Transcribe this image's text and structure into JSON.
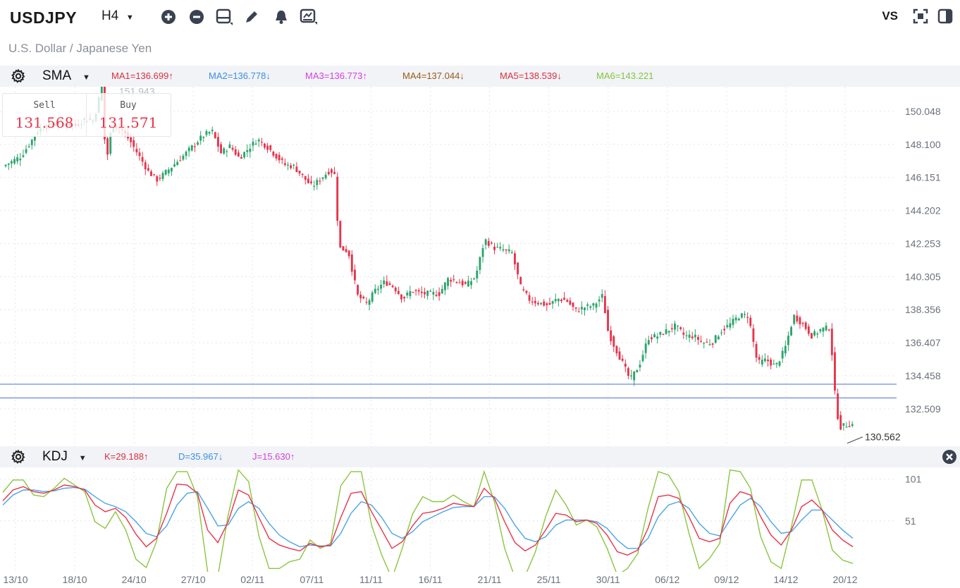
{
  "header": {
    "symbol": "USDJPY",
    "subtitle": "U.S. Dollar / Japanese Yen",
    "timeframe": "H4",
    "compare_label": "VS",
    "icons": [
      "zoom-in-icon",
      "zoom-out-icon",
      "layout-icon",
      "draw-pencil-icon",
      "alert-bell-icon",
      "indicator-chart-icon",
      "fullscreen-icon",
      "panel-toggle-icon"
    ]
  },
  "main_indicator": {
    "name": "SMA",
    "values": [
      {
        "label": "MA1=136.699↑",
        "color": "#d9303f"
      },
      {
        "label": "MA2=136.778↓",
        "color": "#3b8fe0"
      },
      {
        "label": "MA3=136.773↑",
        "color": "#d63fe0"
      },
      {
        "label": "MA4=137.044↓",
        "color": "#9a5a16"
      },
      {
        "label": "MA5=138.539↓",
        "color": "#d9303f"
      },
      {
        "label": "MA6=143.221",
        "color": "#86c43a"
      }
    ]
  },
  "sub_indicator": {
    "name": "KDJ",
    "values": [
      {
        "label": "K=29.188↑",
        "color": "#d9303f"
      },
      {
        "label": "D=35.967↓",
        "color": "#3b8fe0"
      },
      {
        "label": "J=15.630↑",
        "color": "#d63fe0"
      }
    ]
  },
  "trade": {
    "sell_label": "Sell",
    "sell_price": "131.568",
    "buy_label": "Buy",
    "buy_price": "131.571"
  },
  "annotations": {
    "high_label": "151.943",
    "low_label": "130.562"
  },
  "colors": {
    "up": "#2aa56b",
    "down": "#e8334a",
    "hline": "#5b7fd6",
    "k": "#e8334a",
    "d": "#4aa3ea",
    "j": "#8bc53f"
  },
  "chart_data": [
    {
      "type": "candlestick",
      "title": "USDJPY H4",
      "y_ticks": [
        "150.048",
        "148.100",
        "146.151",
        "144.202",
        "142.253",
        "140.305",
        "138.356",
        "136.407",
        "134.458",
        "132.509"
      ],
      "x_ticks": [
        "13/10",
        "18/10",
        "24/10",
        "27/10",
        "02/11",
        "07/11",
        "11/11",
        "16/11",
        "21/11",
        "25/11",
        "30/11",
        "06/12",
        "09/12",
        "14/12",
        "20/12"
      ],
      "ylim": [
        130.3,
        151.5
      ],
      "horizontal_lines": [
        133.96,
        133.15
      ],
      "high": 151.943,
      "low": 130.562,
      "close_path": [
        [
          0,
          146.8
        ],
        [
          2,
          147.4
        ],
        [
          4,
          149.0
        ],
        [
          6,
          149.4
        ],
        [
          8,
          149.2
        ],
        [
          9,
          149.6
        ],
        [
          10,
          149.5
        ],
        [
          11,
          151.8
        ],
        [
          11.3,
          146.7
        ],
        [
          12,
          149.3
        ],
        [
          13,
          149.0
        ],
        [
          14,
          148.3
        ],
        [
          16,
          146.5
        ],
        [
          17,
          146.0
        ],
        [
          18,
          146.5
        ],
        [
          20,
          147.5
        ],
        [
          22,
          148.6
        ],
        [
          23,
          148.9
        ],
        [
          24,
          147.6
        ],
        [
          25,
          148.0
        ],
        [
          26,
          147.3
        ],
        [
          28,
          148.4
        ],
        [
          29,
          148.0
        ],
        [
          31,
          146.9
        ],
        [
          32,
          146.8
        ],
        [
          33,
          146.2
        ],
        [
          34,
          145.6
        ],
        [
          36,
          146.6
        ],
        [
          36.5,
          146.3
        ],
        [
          37,
          142.0
        ],
        [
          38,
          141.8
        ],
        [
          39,
          139.2
        ],
        [
          40,
          138.7
        ],
        [
          41,
          139.5
        ],
        [
          42,
          140.0
        ],
        [
          43,
          139.7
        ],
        [
          44,
          139.0
        ],
        [
          45,
          139.5
        ],
        [
          46,
          139.3
        ],
        [
          48,
          139.3
        ],
        [
          49,
          140.2
        ],
        [
          50,
          140.0
        ],
        [
          51,
          139.8
        ],
        [
          52,
          140.3
        ],
        [
          53,
          142.5
        ],
        [
          54,
          142.0
        ],
        [
          55,
          141.9
        ],
        [
          56,
          141.7
        ],
        [
          57,
          139.6
        ],
        [
          58,
          138.9
        ],
        [
          60,
          138.6
        ],
        [
          61,
          139.0
        ],
        [
          62,
          138.9
        ],
        [
          63,
          138.3
        ],
        [
          64,
          138.5
        ],
        [
          65,
          138.6
        ],
        [
          66,
          139.2
        ],
        [
          66.5,
          137.2
        ],
        [
          67,
          136.5
        ],
        [
          68,
          135.4
        ],
        [
          69,
          134.2
        ],
        [
          70,
          135.1
        ],
        [
          71,
          136.7
        ],
        [
          72,
          136.8
        ],
        [
          73,
          137.1
        ],
        [
          74,
          137.4
        ],
        [
          75,
          136.8
        ],
        [
          76,
          136.8
        ],
        [
          77,
          136.4
        ],
        [
          78,
          136.4
        ],
        [
          79,
          137.1
        ],
        [
          80,
          137.5
        ],
        [
          81,
          138.0
        ],
        [
          82,
          138.0
        ],
        [
          83,
          135.2
        ],
        [
          84,
          135.4
        ],
        [
          85,
          135.0
        ],
        [
          86,
          136.0
        ],
        [
          87,
          138.0
        ],
        [
          88,
          137.5
        ],
        [
          89,
          136.8
        ],
        [
          90,
          137.2
        ],
        [
          91,
          137.3
        ],
        [
          91.5,
          133.5
        ],
        [
          92,
          131.4
        ],
        [
          93,
          131.6
        ],
        [
          93.5,
          131.57
        ]
      ]
    },
    {
      "type": "line",
      "title": "KDJ",
      "y_ticks": [
        "101",
        "51"
      ],
      "ylim": [
        -10,
        115
      ],
      "series": [
        {
          "name": "K",
          "values": [
            75,
            88,
            92,
            86,
            84,
            88,
            94,
            92,
            88,
            70,
            62,
            66,
            55,
            35,
            20,
            30,
            60,
            95,
            94,
            84,
            40,
            25,
            50,
            88,
            82,
            55,
            30,
            22,
            18,
            15,
            24,
            20,
            22,
            55,
            84,
            86,
            62,
            40,
            18,
            26,
            45,
            60,
            62,
            66,
            72,
            70,
            68,
            90,
            78,
            50,
            25,
            15,
            22,
            40,
            60,
            58,
            50,
            52,
            48,
            34,
            14,
            10,
            16,
            42,
            80,
            82,
            78,
            56,
            30,
            26,
            30,
            72,
            86,
            82,
            56,
            34,
            22,
            40,
            68,
            76,
            64,
            40,
            28,
            20
          ]
        },
        {
          "name": "D",
          "values": [
            70,
            82,
            88,
            88,
            86,
            87,
            90,
            91,
            89,
            80,
            72,
            68,
            62,
            50,
            36,
            32,
            45,
            70,
            84,
            86,
            66,
            45,
            46,
            66,
            74,
            66,
            48,
            34,
            26,
            20,
            22,
            21,
            21,
            36,
            60,
            74,
            70,
            55,
            36,
            30,
            38,
            50,
            56,
            62,
            67,
            68,
            68,
            80,
            80,
            66,
            46,
            30,
            26,
            32,
            46,
            52,
            52,
            52,
            50,
            42,
            28,
            18,
            18,
            30,
            56,
            70,
            74,
            66,
            48,
            36,
            33,
            52,
            70,
            78,
            68,
            50,
            36,
            38,
            52,
            64,
            64,
            52,
            40,
            30
          ]
        },
        {
          "name": "J",
          "values": [
            85,
            100,
            100,
            82,
            80,
            90,
            102,
            94,
            86,
            50,
            42,
            62,
            40,
            5,
            -5,
            26,
            90,
            110,
            110,
            80,
            -10,
            -15,
            58,
            112,
            98,
            33,
            -6,
            -6,
            2,
            5,
            28,
            18,
            24,
            93,
            110,
            110,
            46,
            10,
            -18,
            18,
            59,
            80,
            74,
            74,
            82,
            74,
            68,
            110,
            74,
            18,
            -17,
            -15,
            14,
            56,
            88,
            70,
            46,
            52,
            44,
            18,
            -14,
            -6,
            12,
            66,
            110,
            106,
            86,
            36,
            -6,
            6,
            24,
            112,
            110,
            90,
            32,
            2,
            -6,
            44,
            100,
            100,
            64,
            16,
            4,
            0
          ]
        }
      ]
    }
  ]
}
